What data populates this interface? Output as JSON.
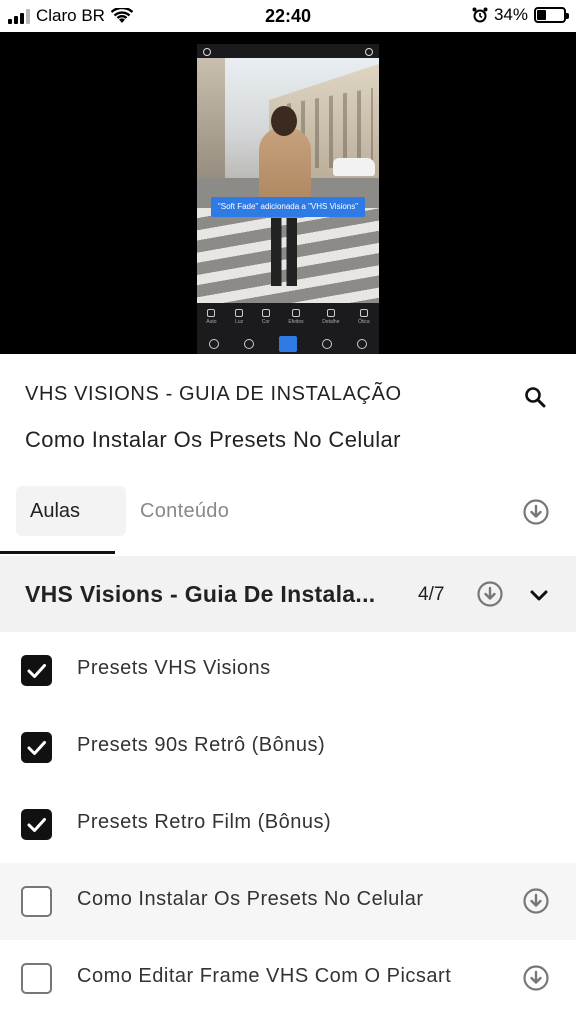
{
  "status_bar": {
    "carrier": "Claro BR",
    "time": "22:40",
    "battery": "34%",
    "battery_level": 0.34,
    "icons": [
      "signal-icon",
      "wifi-icon",
      "alarm-icon",
      "battery-icon"
    ]
  },
  "video": {
    "toast_text": "\"Soft Fade\" adicionada a \"VHS Visions\"",
    "tools": [
      "Auto",
      "Luz",
      "Cor",
      "Efeitos",
      "Detalhe",
      "Ótica"
    ]
  },
  "header": {
    "course_title": "VHS VISIONS - GUIA DE INSTALAÇÃO",
    "lesson_title": "Como Instalar Os Presets No Celular",
    "search_icon": "search-icon"
  },
  "tabs": [
    {
      "label": "Aulas",
      "active": true
    },
    {
      "label": "Conteúdo",
      "active": false
    }
  ],
  "section": {
    "title": "VHS Visions - Guia De Instala...",
    "count": "4/7"
  },
  "lessons": [
    {
      "label": "Presets VHS Visions",
      "checked": true
    },
    {
      "label": "Presets 90s Retrô (Bônus)",
      "checked": true
    },
    {
      "label": "Presets Retro Film (Bônus)",
      "checked": true
    },
    {
      "label": "Como Instalar Os Presets No Celular",
      "checked": false,
      "current": true
    },
    {
      "label": "Como Editar Frame VHS Com O Picsart",
      "checked": false
    }
  ],
  "colors": {
    "accent": "#111111",
    "toast": "#2f7be6",
    "section_bg": "#f2f2f2"
  }
}
